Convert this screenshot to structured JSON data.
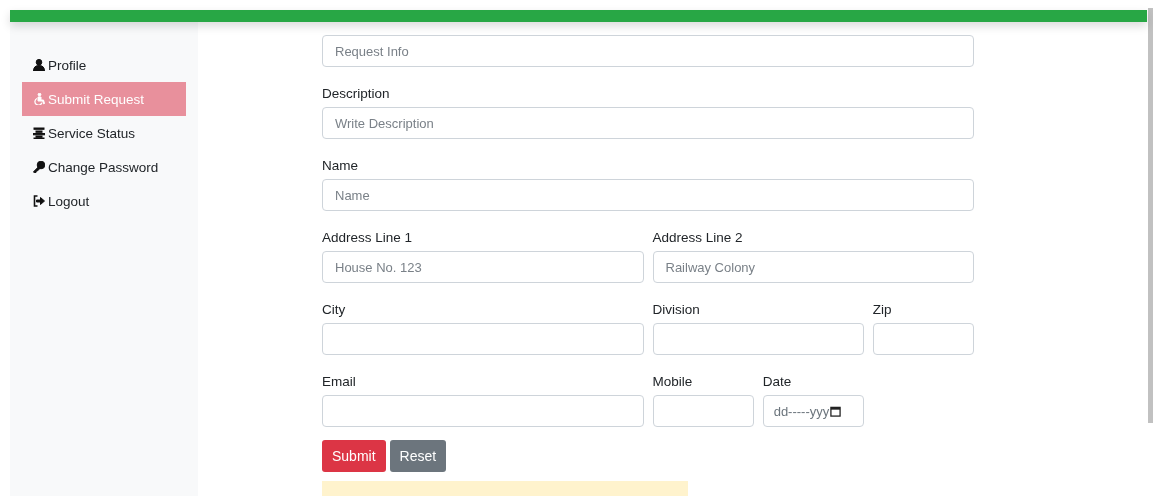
{
  "sidebar": {
    "items": [
      {
        "label": "Profile",
        "selected": false
      },
      {
        "label": "Submit Request",
        "selected": true
      },
      {
        "label": "Service Status",
        "selected": false
      },
      {
        "label": "Change Password",
        "selected": false
      },
      {
        "label": "Logout",
        "selected": false
      }
    ]
  },
  "form": {
    "rows": [
      [
        {
          "kind": "text",
          "placeholder": "Request Info"
        }
      ],
      [
        {
          "kind": "text",
          "label": "Description",
          "placeholder": "Write Description"
        }
      ],
      [
        {
          "kind": "text",
          "label": "Name",
          "placeholder": "Name"
        }
      ],
      [
        {
          "kind": "text",
          "label": "Address Line 1",
          "placeholder": "House No. 123"
        },
        {
          "kind": "text",
          "label": "Address Line 2",
          "placeholder": "Railway Colony"
        }
      ],
      [
        {
          "kind": "text",
          "label": "City"
        },
        {
          "kind": "text",
          "label": "Division"
        },
        {
          "kind": "text",
          "label": "Zip"
        }
      ],
      [
        {
          "kind": "text",
          "label": "Email"
        },
        {
          "kind": "text",
          "label": "Mobile"
        },
        {
          "kind": "date",
          "label": "Date",
          "placeholder": "dd-----yyy"
        }
      ]
    ],
    "buttons": [
      {
        "label": "Submit",
        "kind": "danger"
      },
      {
        "label": "Reset",
        "kind": "secondary"
      }
    ],
    "notice": {
      "kind": "warning"
    }
  }
}
